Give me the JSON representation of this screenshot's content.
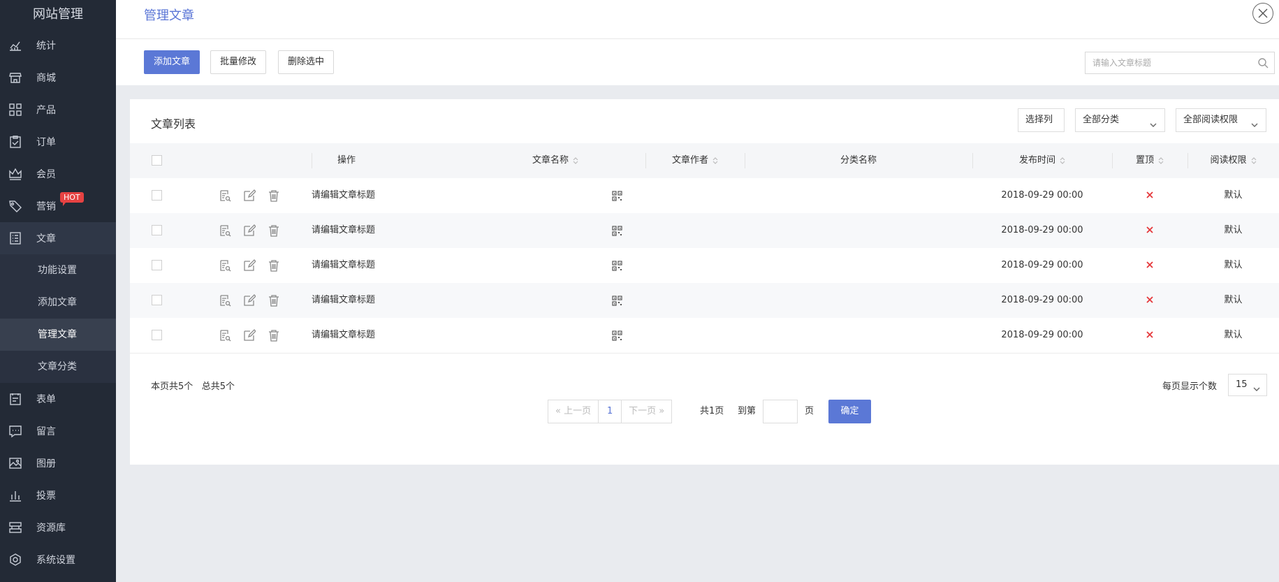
{
  "sidebar": {
    "brand": "网站管理",
    "items": [
      {
        "label": "统计",
        "icon": "chart-line-icon"
      },
      {
        "label": "商城",
        "icon": "store-icon"
      },
      {
        "label": "产品",
        "icon": "grid-icon"
      },
      {
        "label": "订单",
        "icon": "clipboard-icon"
      },
      {
        "label": "会员",
        "icon": "crown-icon"
      },
      {
        "label": "营销",
        "icon": "tag-icon",
        "badge": "HOT"
      },
      {
        "label": "文章",
        "icon": "document-list-icon",
        "expanded": true
      },
      {
        "label": "表单",
        "icon": "form-icon"
      },
      {
        "label": "留言",
        "icon": "message-icon"
      },
      {
        "label": "图册",
        "icon": "image-icon"
      },
      {
        "label": "投票",
        "icon": "bar-chart-icon"
      },
      {
        "label": "资源库",
        "icon": "database-icon"
      },
      {
        "label": "系统设置",
        "icon": "settings-icon"
      }
    ],
    "sub_items": [
      "功能设置",
      "添加文章",
      "管理文章",
      "文章分类"
    ],
    "current_sub": "管理文章"
  },
  "header": {
    "title": "管理文章"
  },
  "toolbar": {
    "add_label": "添加文章",
    "batch_label": "批量修改",
    "delete_label": "删除选中",
    "search_placeholder": "请输入文章标题"
  },
  "card": {
    "title": "文章列表",
    "select_columns": "选择列",
    "category_filter": "全部分类",
    "permission_filter": "全部阅读权限"
  },
  "table": {
    "columns": {
      "actions": "操作",
      "name": "文章名称",
      "author": "文章作者",
      "category": "分类名称",
      "publish_time": "发布时间",
      "pinned": "置顶",
      "permission": "阅读权限"
    },
    "rows": [
      {
        "name": "请编辑文章标题",
        "author": "",
        "category": "",
        "publish_time": "2018-09-29 00:00",
        "pinned": false,
        "permission": "默认"
      },
      {
        "name": "请编辑文章标题",
        "author": "",
        "category": "",
        "publish_time": "2018-09-29 00:00",
        "pinned": false,
        "permission": "默认"
      },
      {
        "name": "请编辑文章标题",
        "author": "",
        "category": "",
        "publish_time": "2018-09-29 00:00",
        "pinned": false,
        "permission": "默认"
      },
      {
        "name": "请编辑文章标题",
        "author": "",
        "category": "",
        "publish_time": "2018-09-29 00:00",
        "pinned": false,
        "permission": "默认"
      },
      {
        "name": "请编辑文章标题",
        "author": "",
        "category": "",
        "publish_time": "2018-09-29 00:00",
        "pinned": false,
        "permission": "默认"
      }
    ]
  },
  "footer": {
    "page_count_info": "本页共5个",
    "total_info": "总共5个",
    "prev_label": "上一页",
    "current_page": "1",
    "next_label": "下一页",
    "total_pages": "共1页",
    "goto_label": "到第",
    "page_unit": "页",
    "confirm_label": "确定",
    "per_page_label": "每页显示个数",
    "per_page_value": "15"
  },
  "colors": {
    "accent": "#5b78d6",
    "sidebar_bg": "#232a36",
    "danger": "#e5383b",
    "hot_badge": "#e64242"
  }
}
